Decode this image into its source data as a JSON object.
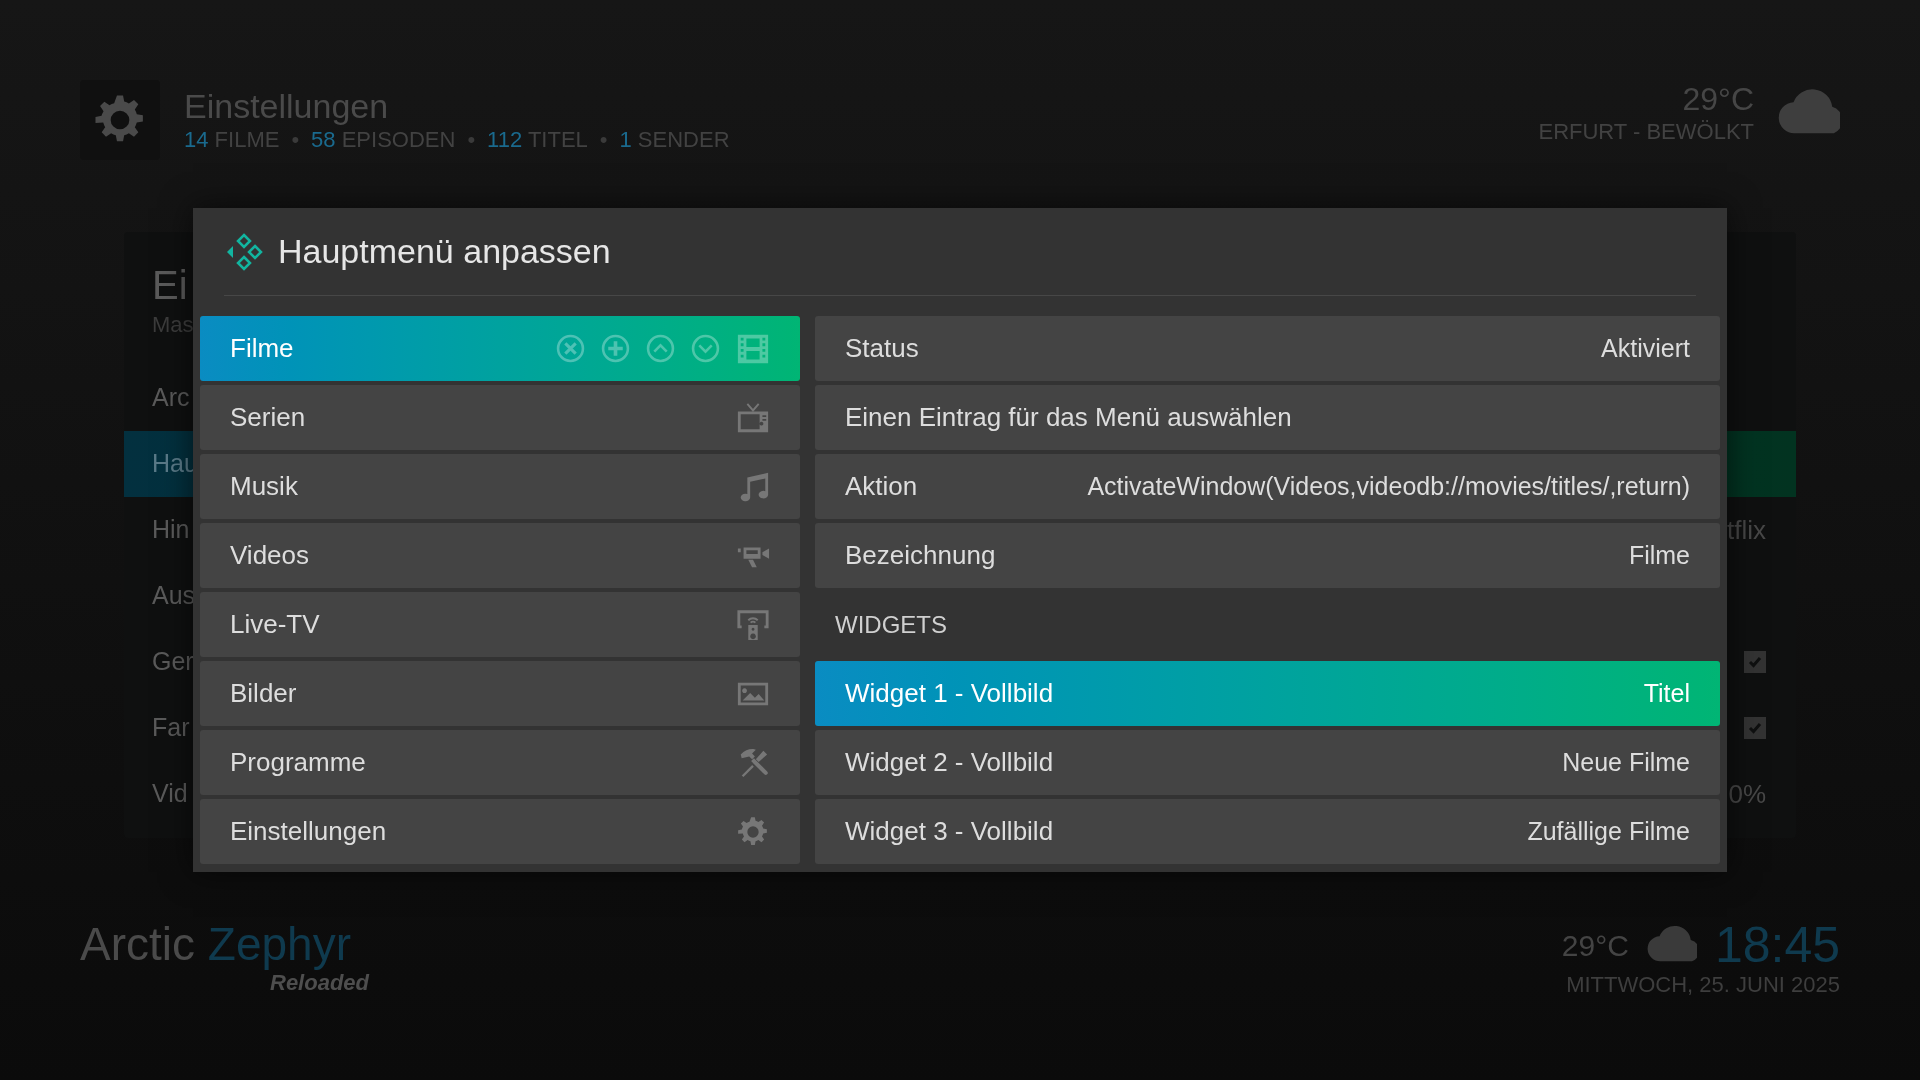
{
  "header": {
    "title": "Einstellungen",
    "stats": [
      {
        "count": "14",
        "label": "FILME"
      },
      {
        "count": "58",
        "label": "EPISODEN"
      },
      {
        "count": "112",
        "label": "TITEL"
      },
      {
        "count": "1",
        "label": "SENDER"
      }
    ],
    "separator": "•",
    "weather": {
      "temperature": "29°C",
      "location": "ERFURT - BEWÖLKT"
    }
  },
  "background_panel": {
    "title": "Ei",
    "subtitle": "Mas",
    "items": [
      {
        "label": "Arc",
        "selected": false
      },
      {
        "label": "Hau",
        "selected": true
      },
      {
        "label": "Hin",
        "selected": false,
        "value": "tflix"
      },
      {
        "label": "Aus",
        "selected": false
      },
      {
        "label": "Ger",
        "selected": false,
        "checked": true
      },
      {
        "label": "Far",
        "selected": false,
        "checked": true
      },
      {
        "label": "Vid",
        "selected": false,
        "value": "0%"
      }
    ]
  },
  "dialog": {
    "title": "Hauptmenü anpassen",
    "menu_items": [
      {
        "label": "Filme",
        "selected": true
      },
      {
        "label": "Serien",
        "selected": false
      },
      {
        "label": "Musik",
        "selected": false
      },
      {
        "label": "Videos",
        "selected": false
      },
      {
        "label": "Live-TV",
        "selected": false
      },
      {
        "label": "Bilder",
        "selected": false
      },
      {
        "label": "Programme",
        "selected": false
      },
      {
        "label": "Einstellungen",
        "selected": false
      }
    ],
    "settings": [
      {
        "kind": "row",
        "label": "Status",
        "value": "Aktiviert",
        "selected": false
      },
      {
        "kind": "row",
        "label": "Einen Eintrag für das Menü auswählen",
        "selected": false
      },
      {
        "kind": "row",
        "label": "Aktion",
        "value": "ActivateWindow(Videos,videodb://movies/titles/,return)",
        "selected": false
      },
      {
        "kind": "row",
        "label": "Bezeichnung",
        "value": "Filme",
        "selected": false
      },
      {
        "kind": "section",
        "label": "WIDGETS"
      },
      {
        "kind": "row",
        "label": "Widget 1 - Vollbild",
        "value": "Titel",
        "selected": true
      },
      {
        "kind": "row",
        "label": "Widget 2 - Vollbild",
        "value": "Neue Filme",
        "selected": false
      },
      {
        "kind": "row",
        "label": "Widget 3 - Vollbild",
        "value": "Zufällige Filme",
        "selected": false
      }
    ]
  },
  "footer": {
    "brand_first": "Arctic",
    "brand_second": "Zephyr",
    "subtitle": "Reloaded",
    "temperature": "29°C",
    "time": "18:45",
    "date": "MITTWOCH, 25. JUNI 2025"
  }
}
